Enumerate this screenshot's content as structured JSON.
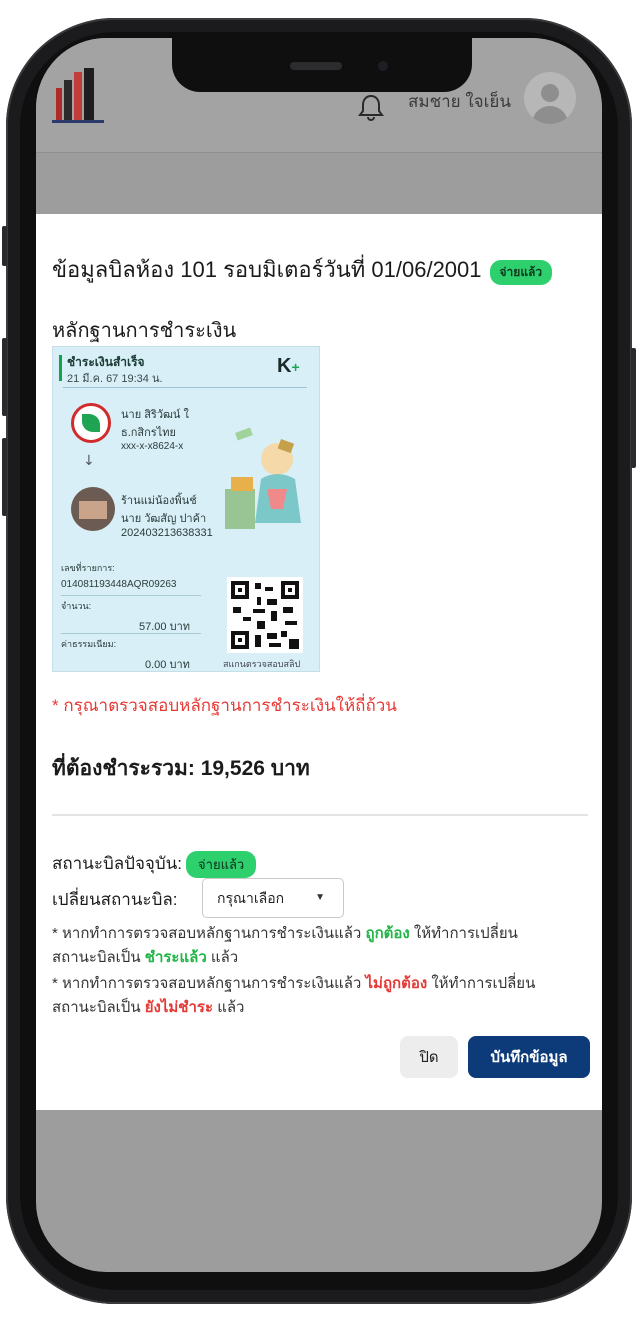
{
  "header": {
    "user_name": "สมชาย ใจเย็น",
    "icons": [
      "building-logo",
      "bell-icon",
      "avatar"
    ]
  },
  "modal": {
    "title": "ข้อมูลบิลห้อง 101 รอบมิเตอร์วันที่ 01/06/2001",
    "title_badge": "จ่ายแล้ว",
    "evidence_heading": "หลักฐานการชำระเงิน",
    "slip": {
      "status": "ชำระเงินสำเร็จ",
      "datetime": "21 มี.ค. 67 19:34 น.",
      "brand": "K",
      "brand_plus": "+",
      "from_name": "นาย สิริวัฒน์ ใ",
      "from_bank": "ธ.กสิกรไทย",
      "from_account": "xxx-x-x8624-x",
      "to_name": "ร้านแม่น้องพิ้นช์",
      "to_owner": "นาย วัฒสัญ ปาค้า",
      "to_id": "202403213638331",
      "ref_label": "เลขที่รายการ:",
      "ref_value": "014081193448AQR09263",
      "amount_label": "จำนวน:",
      "amount_value": "57.00 บาท",
      "fee_label": "ค่าธรรมเนียม:",
      "fee_value": "0.00 บาท",
      "qr_label": "สแกนตรวจสอบสลิป"
    },
    "warning": "* กรุณาตรวจสอบหลักฐานการชำระเงินให้ถี่ถ้วน",
    "total": "ที่ต้องชำระรวม: 19,526 บาท",
    "current_status_label": "สถานะบิลปัจจุบัน:",
    "current_status_badge": "จ่ายแล้ว",
    "change_status_label": "เปลี่ยนสถานะบิล:",
    "select_value": "กรุณาเลือก",
    "note1_a": "* หากทำการตรวจสอบหลักฐานการชำระเงินแล้ว ",
    "note1_b": "ถูกต้อง",
    "note1_c": " ให้ทำการเปลี่ยน",
    "note1_d": "สถานะบิลเป็น ",
    "note1_e": "ชำระแล้ว",
    "note1_f": " แล้ว",
    "note2_a": "* หากทำการตรวจสอบหลักฐานการชำระเงินแล้ว ",
    "note2_b": "ไม่ถูกต้อง",
    "note2_c": " ให้ทำการเปลี่ยน",
    "note2_d": "สถานะบิลเป็น ",
    "note2_e": "ยังไม่ชำระ",
    "note2_f": " แล้ว",
    "close_label": "ปิด",
    "save_label": "บันทึกข้อมูล"
  },
  "colors": {
    "badge_green": "#2ed06e",
    "primary": "#0d3a78",
    "warning": "#e53935"
  }
}
